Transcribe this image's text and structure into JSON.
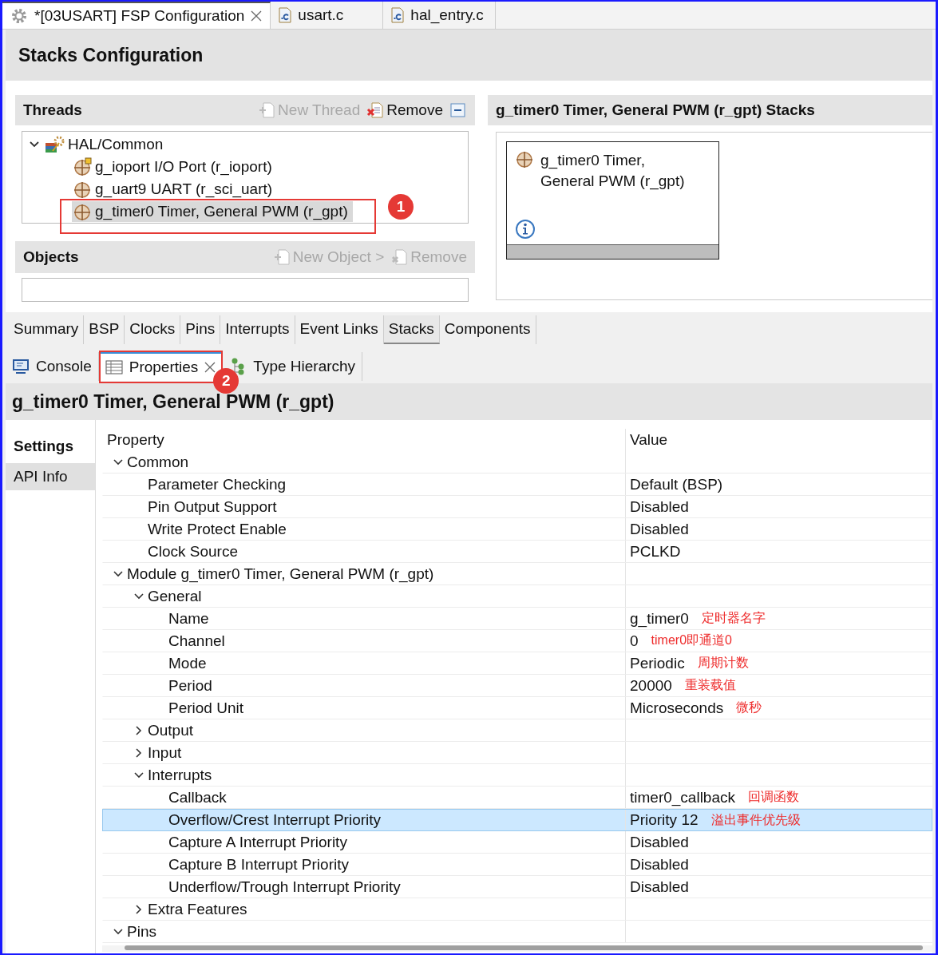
{
  "editor_tabs": [
    {
      "label": "*[03USART] FSP Configuration",
      "kind": "config",
      "selected": true,
      "closable": true
    },
    {
      "label": "usart.c",
      "kind": "c",
      "selected": false
    },
    {
      "label": "hal_entry.c",
      "kind": "c",
      "selected": false
    }
  ],
  "header": {
    "title": "Stacks Configuration"
  },
  "threads": {
    "title": "Threads",
    "new_button": {
      "label": "New Thread",
      "disabled": true
    },
    "remove_button": {
      "label": "Remove",
      "disabled": false
    },
    "tree": [
      {
        "label": "HAL/Common",
        "kind": "group",
        "expanded": true,
        "selected": false,
        "children": [
          {
            "label": "g_ioport I/O Port (r_ioport)",
            "kind": "port",
            "selected": false
          },
          {
            "label": "g_uart9 UART (r_sci_uart)",
            "kind": "module",
            "selected": false
          },
          {
            "label": "g_timer0 Timer, General PWM (r_gpt)",
            "kind": "module",
            "selected": true,
            "callout": "1"
          }
        ]
      }
    ]
  },
  "objects": {
    "title": "Objects",
    "new_button": {
      "label": "New Object >",
      "disabled": true
    },
    "remove_button": {
      "label": "Remove",
      "disabled": true
    }
  },
  "stacks": {
    "title": "g_timer0 Timer, General PWM (r_gpt) Stacks",
    "card": {
      "line1": "g_timer0 Timer,",
      "line2": "General PWM (r_gpt)"
    }
  },
  "config_tabs": [
    {
      "label": "Summary",
      "selected": false
    },
    {
      "label": "BSP",
      "selected": false
    },
    {
      "label": "Clocks",
      "selected": false
    },
    {
      "label": "Pins",
      "selected": false
    },
    {
      "label": "Interrupts",
      "selected": false
    },
    {
      "label": "Event Links",
      "selected": false
    },
    {
      "label": "Stacks",
      "selected": true
    },
    {
      "label": "Components",
      "selected": false
    }
  ],
  "view_tabs": [
    {
      "label": "Console",
      "kind": "console",
      "selected": false
    },
    {
      "label": "Properties",
      "kind": "properties",
      "selected": true,
      "closable": true,
      "callout": "2"
    },
    {
      "label": "Type Hierarchy",
      "kind": "hierarchy",
      "selected": false
    }
  ],
  "properties": {
    "title": "g_timer0 Timer, General PWM (r_gpt)",
    "side_tabs": [
      {
        "label": "Settings",
        "selected": true
      },
      {
        "label": "API Info",
        "selected": false
      }
    ],
    "columns": [
      "Property",
      "Value"
    ],
    "rows": [
      {
        "label": "Common",
        "expanded": true,
        "selected": false,
        "children": [
          {
            "label": "Parameter Checking",
            "value": "Default (BSP)",
            "selected": false
          },
          {
            "label": "Pin Output Support",
            "value": "Disabled",
            "selected": false
          },
          {
            "label": "Write Protect Enable",
            "value": "Disabled",
            "selected": false
          },
          {
            "label": "Clock Source",
            "value": "PCLKD",
            "selected": false
          }
        ]
      },
      {
        "label": "Module g_timer0 Timer, General PWM (r_gpt)",
        "expanded": true,
        "selected": false,
        "children": [
          {
            "label": "General",
            "expanded": true,
            "selected": false,
            "children": [
              {
                "label": "Name",
                "value": "g_timer0",
                "note": "定时器名字",
                "selected": false
              },
              {
                "label": "Channel",
                "value": "0",
                "note": "timer0即通道0",
                "selected": false
              },
              {
                "label": "Mode",
                "value": "Periodic",
                "note": "周期计数",
                "selected": false
              },
              {
                "label": "Period",
                "value": "20000",
                "note": "重装载值",
                "selected": false
              },
              {
                "label": "Period Unit",
                "value": "Microseconds",
                "note": "微秒",
                "selected": false
              }
            ]
          },
          {
            "label": "Output",
            "expanded": false,
            "selected": false
          },
          {
            "label": "Input",
            "expanded": false,
            "selected": false
          },
          {
            "label": "Interrupts",
            "expanded": true,
            "selected": false,
            "children": [
              {
                "label": "Callback",
                "value": "timer0_callback",
                "note": "回调函数",
                "selected": false
              },
              {
                "label": "Overflow/Crest Interrupt Priority",
                "value": "Priority 12",
                "note": "溢出事件优先级",
                "selected": true
              },
              {
                "label": "Capture A Interrupt Priority",
                "value": "Disabled",
                "selected": false
              },
              {
                "label": "Capture B Interrupt Priority",
                "value": "Disabled",
                "selected": false
              },
              {
                "label": "Underflow/Trough Interrupt Priority",
                "value": "Disabled",
                "selected": false
              }
            ]
          },
          {
            "label": "Extra Features",
            "expanded": false,
            "selected": false
          }
        ]
      },
      {
        "label": "Pins",
        "expanded": true,
        "selected": false
      }
    ]
  }
}
